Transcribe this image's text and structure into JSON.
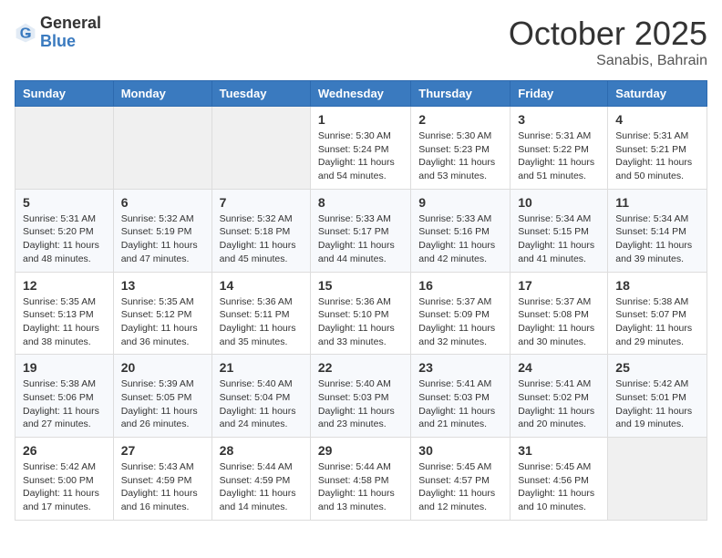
{
  "header": {
    "logo_general": "General",
    "logo_blue": "Blue",
    "month_title": "October 2025",
    "location": "Sanabis, Bahrain"
  },
  "weekdays": [
    "Sunday",
    "Monday",
    "Tuesday",
    "Wednesday",
    "Thursday",
    "Friday",
    "Saturday"
  ],
  "weeks": [
    [
      null,
      null,
      null,
      {
        "day": "1",
        "sunrise": "Sunrise: 5:30 AM",
        "sunset": "Sunset: 5:24 PM",
        "daylight": "Daylight: 11 hours and 54 minutes."
      },
      {
        "day": "2",
        "sunrise": "Sunrise: 5:30 AM",
        "sunset": "Sunset: 5:23 PM",
        "daylight": "Daylight: 11 hours and 53 minutes."
      },
      {
        "day": "3",
        "sunrise": "Sunrise: 5:31 AM",
        "sunset": "Sunset: 5:22 PM",
        "daylight": "Daylight: 11 hours and 51 minutes."
      },
      {
        "day": "4",
        "sunrise": "Sunrise: 5:31 AM",
        "sunset": "Sunset: 5:21 PM",
        "daylight": "Daylight: 11 hours and 50 minutes."
      }
    ],
    [
      {
        "day": "5",
        "sunrise": "Sunrise: 5:31 AM",
        "sunset": "Sunset: 5:20 PM",
        "daylight": "Daylight: 11 hours and 48 minutes."
      },
      {
        "day": "6",
        "sunrise": "Sunrise: 5:32 AM",
        "sunset": "Sunset: 5:19 PM",
        "daylight": "Daylight: 11 hours and 47 minutes."
      },
      {
        "day": "7",
        "sunrise": "Sunrise: 5:32 AM",
        "sunset": "Sunset: 5:18 PM",
        "daylight": "Daylight: 11 hours and 45 minutes."
      },
      {
        "day": "8",
        "sunrise": "Sunrise: 5:33 AM",
        "sunset": "Sunset: 5:17 PM",
        "daylight": "Daylight: 11 hours and 44 minutes."
      },
      {
        "day": "9",
        "sunrise": "Sunrise: 5:33 AM",
        "sunset": "Sunset: 5:16 PM",
        "daylight": "Daylight: 11 hours and 42 minutes."
      },
      {
        "day": "10",
        "sunrise": "Sunrise: 5:34 AM",
        "sunset": "Sunset: 5:15 PM",
        "daylight": "Daylight: 11 hours and 41 minutes."
      },
      {
        "day": "11",
        "sunrise": "Sunrise: 5:34 AM",
        "sunset": "Sunset: 5:14 PM",
        "daylight": "Daylight: 11 hours and 39 minutes."
      }
    ],
    [
      {
        "day": "12",
        "sunrise": "Sunrise: 5:35 AM",
        "sunset": "Sunset: 5:13 PM",
        "daylight": "Daylight: 11 hours and 38 minutes."
      },
      {
        "day": "13",
        "sunrise": "Sunrise: 5:35 AM",
        "sunset": "Sunset: 5:12 PM",
        "daylight": "Daylight: 11 hours and 36 minutes."
      },
      {
        "day": "14",
        "sunrise": "Sunrise: 5:36 AM",
        "sunset": "Sunset: 5:11 PM",
        "daylight": "Daylight: 11 hours and 35 minutes."
      },
      {
        "day": "15",
        "sunrise": "Sunrise: 5:36 AM",
        "sunset": "Sunset: 5:10 PM",
        "daylight": "Daylight: 11 hours and 33 minutes."
      },
      {
        "day": "16",
        "sunrise": "Sunrise: 5:37 AM",
        "sunset": "Sunset: 5:09 PM",
        "daylight": "Daylight: 11 hours and 32 minutes."
      },
      {
        "day": "17",
        "sunrise": "Sunrise: 5:37 AM",
        "sunset": "Sunset: 5:08 PM",
        "daylight": "Daylight: 11 hours and 30 minutes."
      },
      {
        "day": "18",
        "sunrise": "Sunrise: 5:38 AM",
        "sunset": "Sunset: 5:07 PM",
        "daylight": "Daylight: 11 hours and 29 minutes."
      }
    ],
    [
      {
        "day": "19",
        "sunrise": "Sunrise: 5:38 AM",
        "sunset": "Sunset: 5:06 PM",
        "daylight": "Daylight: 11 hours and 27 minutes."
      },
      {
        "day": "20",
        "sunrise": "Sunrise: 5:39 AM",
        "sunset": "Sunset: 5:05 PM",
        "daylight": "Daylight: 11 hours and 26 minutes."
      },
      {
        "day": "21",
        "sunrise": "Sunrise: 5:40 AM",
        "sunset": "Sunset: 5:04 PM",
        "daylight": "Daylight: 11 hours and 24 minutes."
      },
      {
        "day": "22",
        "sunrise": "Sunrise: 5:40 AM",
        "sunset": "Sunset: 5:03 PM",
        "daylight": "Daylight: 11 hours and 23 minutes."
      },
      {
        "day": "23",
        "sunrise": "Sunrise: 5:41 AM",
        "sunset": "Sunset: 5:03 PM",
        "daylight": "Daylight: 11 hours and 21 minutes."
      },
      {
        "day": "24",
        "sunrise": "Sunrise: 5:41 AM",
        "sunset": "Sunset: 5:02 PM",
        "daylight": "Daylight: 11 hours and 20 minutes."
      },
      {
        "day": "25",
        "sunrise": "Sunrise: 5:42 AM",
        "sunset": "Sunset: 5:01 PM",
        "daylight": "Daylight: 11 hours and 19 minutes."
      }
    ],
    [
      {
        "day": "26",
        "sunrise": "Sunrise: 5:42 AM",
        "sunset": "Sunset: 5:00 PM",
        "daylight": "Daylight: 11 hours and 17 minutes."
      },
      {
        "day": "27",
        "sunrise": "Sunrise: 5:43 AM",
        "sunset": "Sunset: 4:59 PM",
        "daylight": "Daylight: 11 hours and 16 minutes."
      },
      {
        "day": "28",
        "sunrise": "Sunrise: 5:44 AM",
        "sunset": "Sunset: 4:59 PM",
        "daylight": "Daylight: 11 hours and 14 minutes."
      },
      {
        "day": "29",
        "sunrise": "Sunrise: 5:44 AM",
        "sunset": "Sunset: 4:58 PM",
        "daylight": "Daylight: 11 hours and 13 minutes."
      },
      {
        "day": "30",
        "sunrise": "Sunrise: 5:45 AM",
        "sunset": "Sunset: 4:57 PM",
        "daylight": "Daylight: 11 hours and 12 minutes."
      },
      {
        "day": "31",
        "sunrise": "Sunrise: 5:45 AM",
        "sunset": "Sunset: 4:56 PM",
        "daylight": "Daylight: 11 hours and 10 minutes."
      },
      null
    ]
  ]
}
